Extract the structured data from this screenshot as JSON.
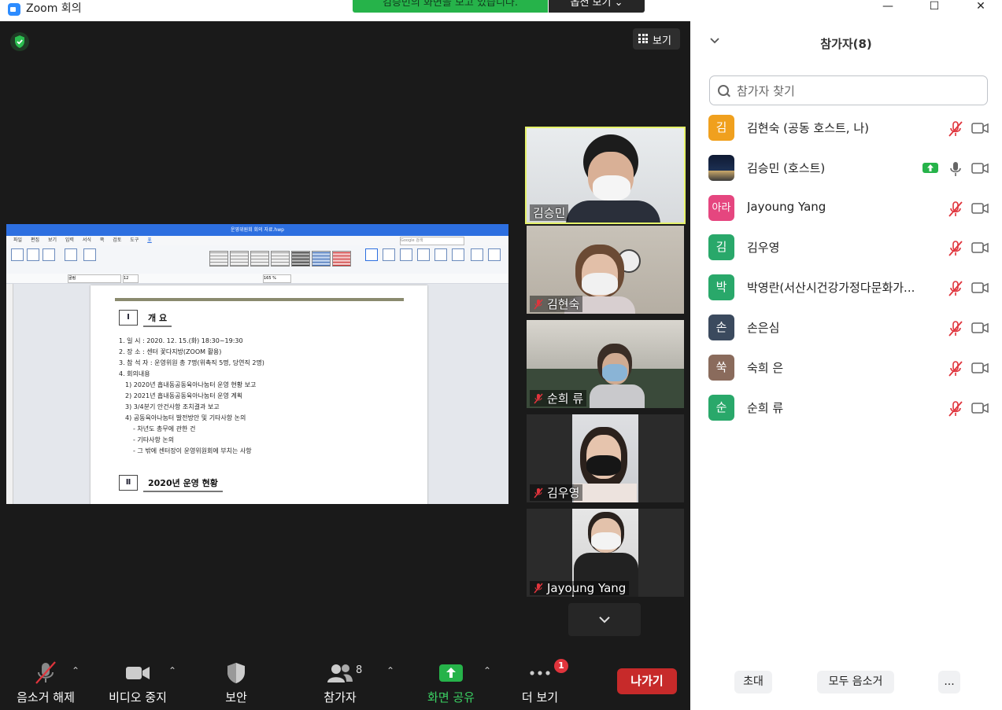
{
  "window": {
    "title": "Zoom 회의",
    "banner_text": "김승민의 화면을 보고 있습니다.",
    "view_options_label": "옵션 보기",
    "controls": {
      "minimize": "—",
      "maximize": "☐",
      "close": "✕"
    }
  },
  "video": {
    "gallery_label": "보기",
    "shared_doc": {
      "window_title": "운영위원회 회의 자료.hwp",
      "menu": [
        "파일",
        "편집",
        "보기",
        "입력",
        "서식",
        "쪽",
        "검토",
        "도구",
        "표"
      ],
      "search_placeholder": "Google 검색",
      "zoom_level": "165 %",
      "font_name": "굴림",
      "font_size": "12",
      "section1": {
        "num": "Ⅰ",
        "title": "개      요"
      },
      "lines": [
        "1. 일      시 : 2020. 12. 15.(화) 18:30~19:30",
        "2. 장      소 : 센터 꽃다지방(ZOOM 활용)",
        "3. 참 석 자 : 운영위원 총 7명(위촉직 5명, 당연직 2명)",
        "4. 회의내용",
        "1) 2020년 흡내동공동육아나눔터 운영 현황 보고",
        "2) 2021년 흡내동공동육아나눔터 운영 계획",
        "3) 3/4분기 안건사항 조치결과 보고",
        "4) 공동육아나눔터 발전방안 및 기타사항 논의",
        "- 차년도 총무에 관한 건",
        "- 기타사항 논의",
        "- 그 밖에 센터장이 운영위원회에 부치는 사항"
      ],
      "section2": {
        "num": "Ⅱ",
        "title": "2020년  운영  현황"
      }
    },
    "thumbnails": [
      {
        "name": "김승민",
        "muted": false,
        "active": true
      },
      {
        "name": "김현숙",
        "muted": true
      },
      {
        "name": "순희 류",
        "muted": true
      },
      {
        "name": "김우영",
        "muted": true
      },
      {
        "name": "Jayoung Yang",
        "muted": true
      }
    ]
  },
  "toolbar": {
    "unmute_label": "음소거 해제",
    "video_label": "비디오 중지",
    "security_label": "보안",
    "participants_label": "참가자",
    "participants_count": "8",
    "share_label": "화면 공유",
    "more_label": "더 보기",
    "more_badge": "1",
    "leave_label": "나가기"
  },
  "panel": {
    "title": "참가자(8)",
    "search_placeholder": "참가자 찾기",
    "participants": [
      {
        "avatar": "김",
        "color": "#f0a01e",
        "name": "김현숙 (공동 호스트, 나)",
        "muted": true,
        "sharing": false,
        "photo": false
      },
      {
        "avatar": "",
        "color": "#1d2b45",
        "name": "김승민 (호스트)",
        "muted": false,
        "sharing": true,
        "photo": true
      },
      {
        "avatar": "아라",
        "color": "#e5467f",
        "name": "Jayoung Yang",
        "muted": true,
        "sharing": false,
        "photo": false
      },
      {
        "avatar": "김",
        "color": "#29a86a",
        "name": "김우영",
        "muted": true,
        "sharing": false,
        "photo": false
      },
      {
        "avatar": "박",
        "color": "#29a86a",
        "name": "박영란(서산시건강가정다문화가...",
        "muted": true,
        "sharing": false,
        "photo": false
      },
      {
        "avatar": "손",
        "color": "#3b4a5e",
        "name": "손은심",
        "muted": true,
        "sharing": false,
        "photo": false
      },
      {
        "avatar": "쑥",
        "color": "#8a6b5c",
        "name": "숙희 은",
        "muted": true,
        "sharing": false,
        "photo": false
      },
      {
        "avatar": "순",
        "color": "#29a86a",
        "name": "순희 류",
        "muted": true,
        "sharing": false,
        "photo": false
      }
    ],
    "footer": {
      "invite": "초대",
      "mute_all": "모두 음소거",
      "more": "..."
    }
  },
  "colors": {
    "accent_green": "#26b34a",
    "leave_red": "#c72a2a",
    "mute_red": "#e0343c",
    "active_speaker": "#e6f26a"
  }
}
